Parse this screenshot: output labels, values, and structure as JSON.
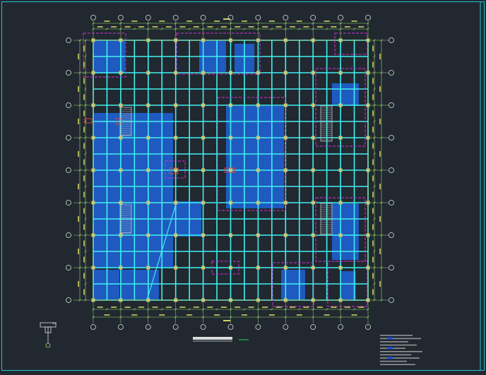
{
  "drawing": {
    "background": "#212830",
    "frame_color": "#20c8d8",
    "colors": {
      "grid_beam": "#40f0f0",
      "slab_fill": "#1f5fd0",
      "column": "#c8c878",
      "axis_line": "#9ad870",
      "dimension": "#d0d060",
      "zone": "#d030d0",
      "opening": "#e04040",
      "stair": "#c0c0c0",
      "text": "#e8e8e8",
      "note_text": "#b8b8b8",
      "bubble": "#e0e0e0"
    },
    "axis_ticks_x": 11,
    "axis_ticks_y": 9,
    "title_label": "",
    "scale_label": "",
    "notes_header": "",
    "notes_lines": []
  }
}
